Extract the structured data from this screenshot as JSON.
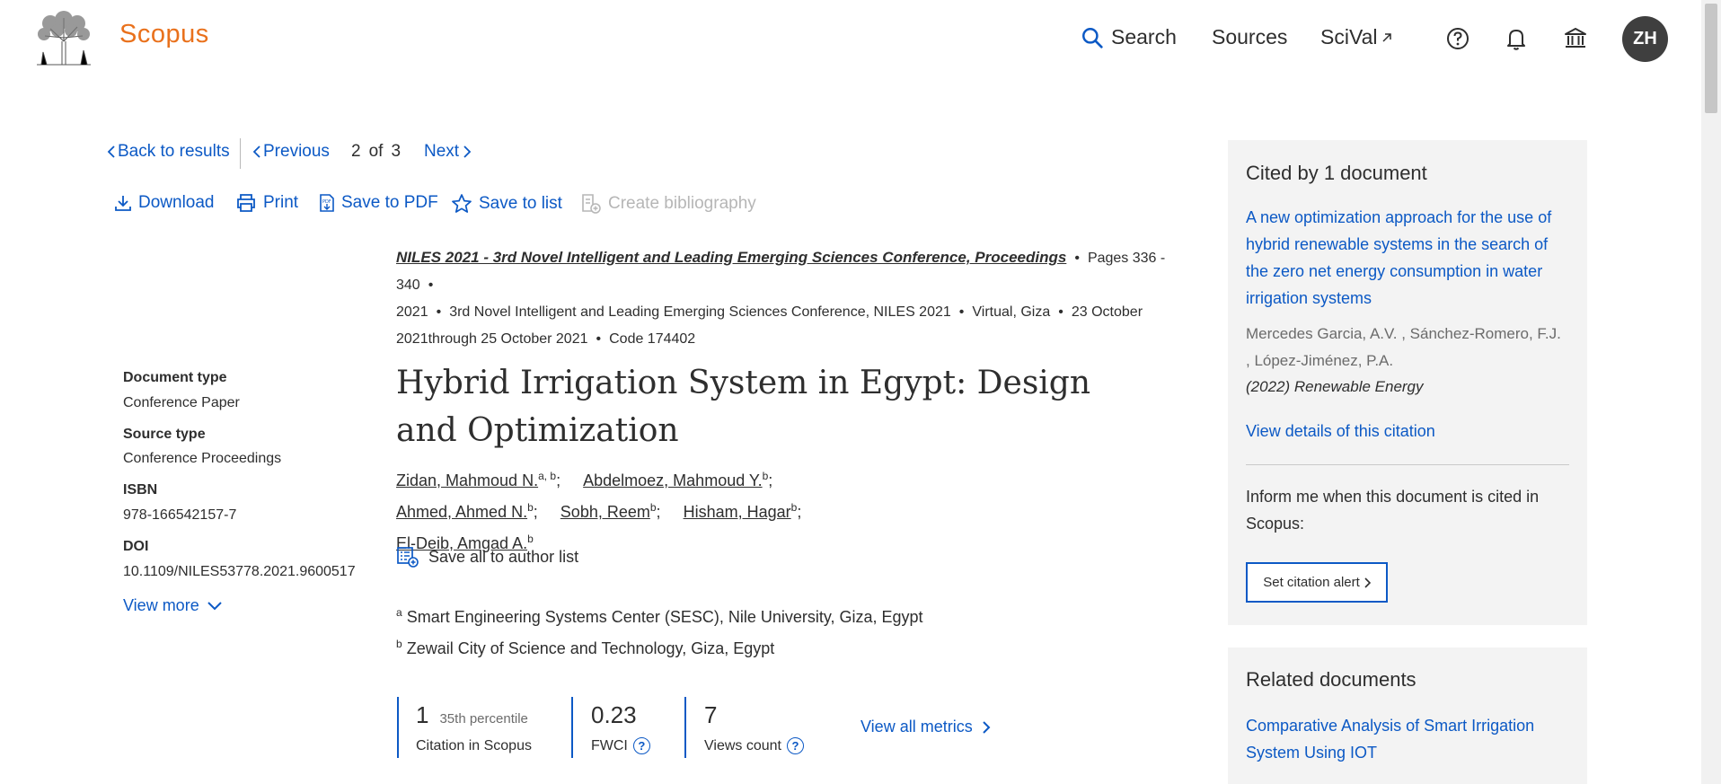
{
  "header": {
    "brand": "Scopus",
    "nav": {
      "search": "Search",
      "sources": "Sources",
      "scival": "SciVal"
    },
    "avatar_initials": "ZH"
  },
  "pager": {
    "back": "Back to results",
    "previous": "Previous",
    "current": "2",
    "of_label": "of",
    "total": "3",
    "next": "Next"
  },
  "toolbar": {
    "download": "Download",
    "print": "Print",
    "save_pdf": "Save to PDF",
    "save_list": "Save to list",
    "bibliography": "Create bibliography"
  },
  "source": {
    "title": "NILES 2021 - 3rd Novel Intelligent and Leading Emerging Sciences Conference, Proceedings",
    "pages": "Pages 336 - 340",
    "year": "2021",
    "conference": "3rd Novel Intelligent and Leading Emerging Sciences Conference, NILES 2021",
    "location": "Virtual, Giza",
    "dates": "23 October 2021through 25 October 2021",
    "code": "Code 174402"
  },
  "meta": {
    "doc_type_label": "Document type",
    "doc_type": "Conference Paper",
    "source_type_label": "Source type",
    "source_type": "Conference Proceedings",
    "isbn_label": "ISBN",
    "isbn": "978-166542157-7",
    "doi_label": "DOI",
    "doi": "10.1109/NILES53778.2021.9600517",
    "view_more": "View more"
  },
  "document": {
    "title": "Hybrid Irrigation System in Egypt: Design and Optimization",
    "authors": [
      {
        "name": "Zidan, Mahmoud N.",
        "sup": "a, b"
      },
      {
        "name": "Abdelmoez, Mahmoud Y.",
        "sup": "b"
      },
      {
        "name": "Ahmed, Ahmed N.",
        "sup": "b"
      },
      {
        "name": "Sobh, Reem",
        "sup": "b"
      },
      {
        "name": "Hisham, Hagar",
        "sup": "b"
      },
      {
        "name": "El-Deib, Amgad A.",
        "sup": "b"
      }
    ],
    "save_authors": "Save all to author list",
    "affiliations": [
      {
        "sup": "a",
        "text": "Smart Engineering Systems Center (SESC), Nile University, Giza, Egypt"
      },
      {
        "sup": "b",
        "text": "Zewail City of Science and Technology, Giza, Egypt"
      }
    ]
  },
  "metrics": {
    "citations": "1",
    "percentile": "35th percentile",
    "citations_label": "Citation in Scopus",
    "fwci": "0.23",
    "fwci_label": "FWCI",
    "views": "7",
    "views_label": "Views count",
    "view_all": "View all metrics"
  },
  "cited_by": {
    "heading": "Cited by 1 document",
    "item_title": "A new optimization approach for the use of hybrid renewable systems in the search of the zero net energy consumption in water irrigation systems",
    "item_authors": "Mercedes Garcia, A.V. , Sánchez-Romero, F.J. , López-Jiménez, P.A.",
    "item_source": "(2022) Renewable Energy",
    "view_details": "View details of this citation",
    "inform": "Inform me when this document is cited in Scopus:",
    "alert_button": "Set citation alert"
  },
  "related": {
    "heading": "Related documents",
    "item_title": "Comparative Analysis of Smart Irrigation System Using IOT"
  },
  "colors": {
    "brand": "#e9711c",
    "link": "#0c59c5",
    "panel": "#f3f3f3"
  }
}
